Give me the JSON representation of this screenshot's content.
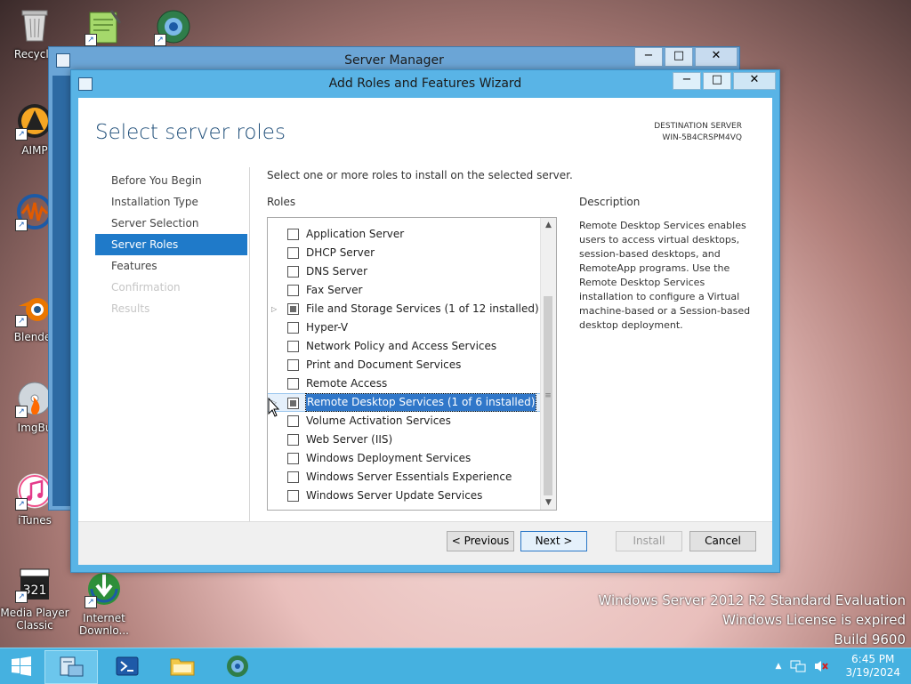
{
  "desktop": {
    "icons": [
      {
        "label": "Recycle"
      },
      {
        "label": ""
      },
      {
        "label": ""
      },
      {
        "label": "AIMP"
      },
      {
        "label": ""
      },
      {
        "label": "Blender"
      },
      {
        "label": "ImgBu"
      },
      {
        "label": "iTunes"
      },
      {
        "label": "Media Player Classic"
      },
      {
        "label": "Internet Downlo..."
      }
    ]
  },
  "server_manager": {
    "title": "Server Manager",
    "min": "−",
    "max": "□",
    "close": "✕"
  },
  "wizard": {
    "title": "Add Roles and Features Wizard",
    "min": "−",
    "max": "□",
    "close": "✕",
    "page_title": "Select server roles",
    "destination_label": "DESTINATION SERVER",
    "destination_name": "WIN-5B4CRSPM4VQ",
    "nav": [
      {
        "label": "Before You Begin",
        "state": "normal"
      },
      {
        "label": "Installation Type",
        "state": "normal"
      },
      {
        "label": "Server Selection",
        "state": "normal"
      },
      {
        "label": "Server Roles",
        "state": "active"
      },
      {
        "label": "Features",
        "state": "normal"
      },
      {
        "label": "Confirmation",
        "state": "disabled"
      },
      {
        "label": "Results",
        "state": "disabled"
      }
    ],
    "intro": "Select one or more roles to install on the selected server.",
    "roles_label": "Roles",
    "roles": [
      {
        "label": "Application Server",
        "check": "none",
        "expandable": false,
        "selected": false
      },
      {
        "label": "DHCP Server",
        "check": "none",
        "expandable": false,
        "selected": false
      },
      {
        "label": "DNS Server",
        "check": "none",
        "expandable": false,
        "selected": false
      },
      {
        "label": "Fax Server",
        "check": "none",
        "expandable": false,
        "selected": false
      },
      {
        "label": "File and Storage Services (1 of 12 installed)",
        "check": "partial",
        "expandable": true,
        "selected": false
      },
      {
        "label": "Hyper-V",
        "check": "none",
        "expandable": false,
        "selected": false
      },
      {
        "label": "Network Policy and Access Services",
        "check": "none",
        "expandable": false,
        "selected": false
      },
      {
        "label": "Print and Document Services",
        "check": "none",
        "expandable": false,
        "selected": false
      },
      {
        "label": "Remote Access",
        "check": "none",
        "expandable": false,
        "selected": false
      },
      {
        "label": "Remote Desktop Services (1 of 6 installed)",
        "check": "partial",
        "expandable": true,
        "selected": true
      },
      {
        "label": "Volume Activation Services",
        "check": "none",
        "expandable": false,
        "selected": false
      },
      {
        "label": "Web Server (IIS)",
        "check": "none",
        "expandable": false,
        "selected": false
      },
      {
        "label": "Windows Deployment Services",
        "check": "none",
        "expandable": false,
        "selected": false
      },
      {
        "label": "Windows Server Essentials Experience",
        "check": "none",
        "expandable": false,
        "selected": false
      },
      {
        "label": "Windows Server Update Services",
        "check": "none",
        "expandable": false,
        "selected": false
      }
    ],
    "description_label": "Description",
    "description": "Remote Desktop Services enables users to access virtual desktops, session-based desktops, and RemoteApp programs. Use the Remote Desktop Services installation to configure a Virtual machine-based or a Session-based desktop deployment.",
    "buttons": {
      "previous": "< Previous",
      "next": "Next >",
      "install": "Install",
      "cancel": "Cancel"
    }
  },
  "watermark": {
    "line1": "Windows Server 2012 R2 Standard Evaluation",
    "line2": "Windows License is expired",
    "line3": "Build 9600"
  },
  "taskbar": {
    "time": "6:45 PM",
    "date": "3/19/2024",
    "tray_expand": "▲"
  }
}
